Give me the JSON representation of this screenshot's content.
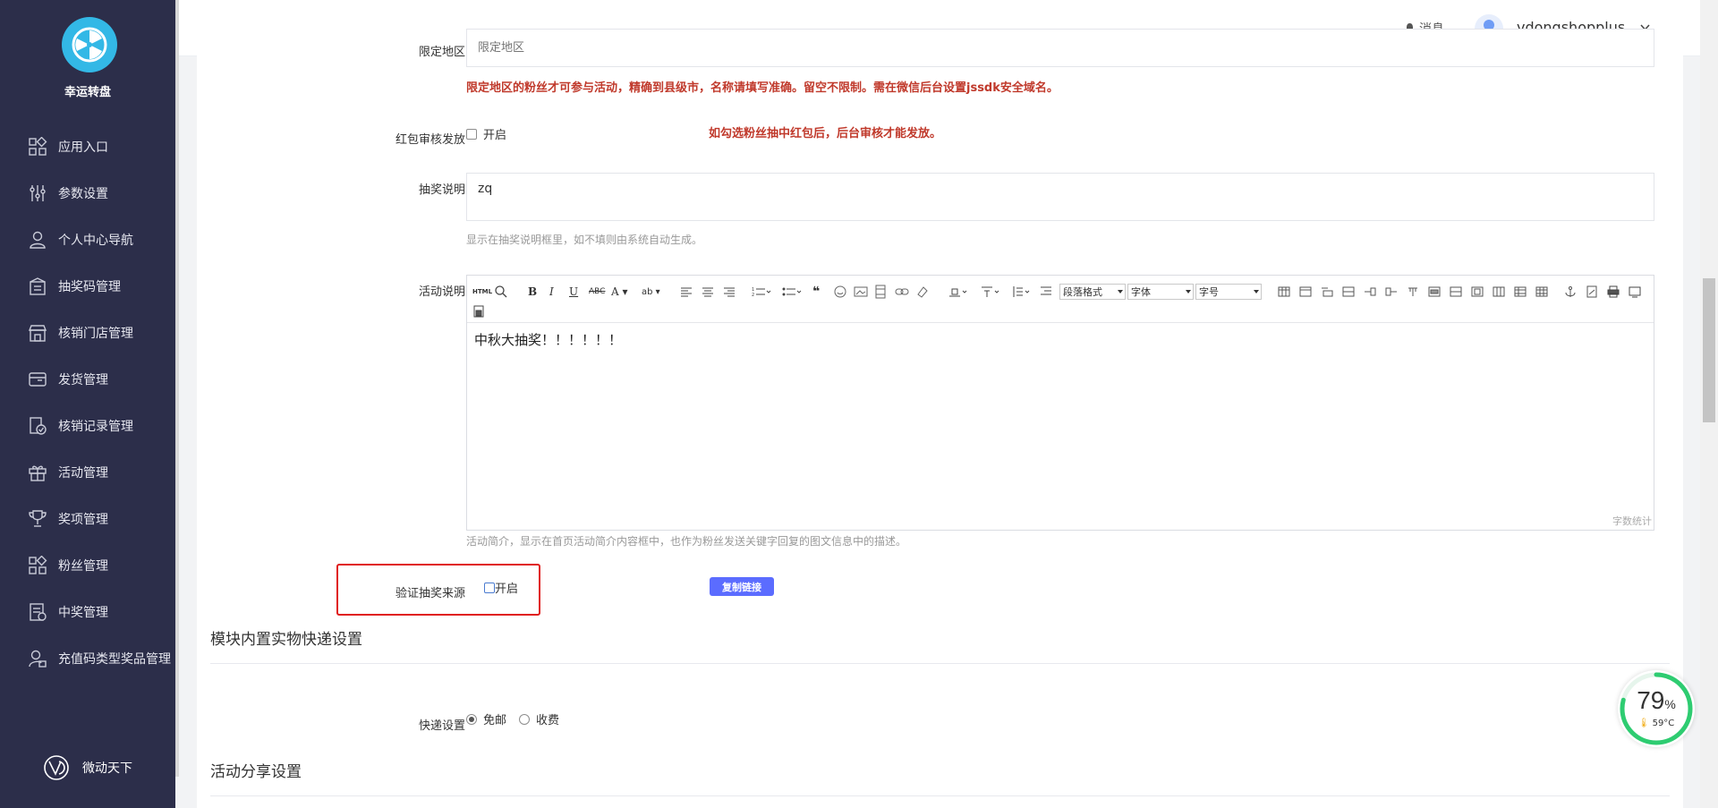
{
  "sidebar": {
    "app_name": "幸运转盘",
    "items": [
      {
        "label": "应用入口",
        "icon": "grid-icon"
      },
      {
        "label": "参数设置",
        "icon": "sliders-icon"
      },
      {
        "label": "个人中心导航",
        "icon": "user-icon"
      },
      {
        "label": "抽奖码管理",
        "icon": "ticket-icon"
      },
      {
        "label": "核销门店管理",
        "icon": "store-icon"
      },
      {
        "label": "发货管理",
        "icon": "shipping-icon"
      },
      {
        "label": "核销记录管理",
        "icon": "record-check-icon"
      },
      {
        "label": "活动管理",
        "icon": "gift-icon"
      },
      {
        "label": "奖项管理",
        "icon": "trophy-icon"
      },
      {
        "label": "粉丝管理",
        "icon": "fans-icon"
      },
      {
        "label": "中奖管理",
        "icon": "prize-list-icon"
      },
      {
        "label": "充值码类型奖品管理",
        "icon": "recharge-icon"
      }
    ],
    "footer": "微动天下"
  },
  "header": {
    "messages": "消息",
    "username": "vdongshopplus"
  },
  "form": {
    "region": {
      "label": "限定地区",
      "placeholder": "限定地区",
      "hint": "限定地区的粉丝才可参与活动，精确到县级市，名称请填写准确。留空不限制。需在微信后台设置jssdk安全域名。"
    },
    "redpack_review": {
      "label": "红包审核发放",
      "option": "开启",
      "checked": false,
      "hint": "如勾选粉丝抽中红包后，后台审核才能发放。"
    },
    "lottery_desc": {
      "label": "抽奖说明",
      "value": "zq",
      "hint": "显示在抽奖说明框里，如不填则由系统自动生成。"
    },
    "activity_desc": {
      "label": "活动说明",
      "content": "中秋大抽奖！！！！！！",
      "word_count": "字数统计",
      "hint": "活动简介，显示在首页活动简介内容框中，也作为粉丝发送关键字回复的图文信息中的描述。",
      "toolbar": {
        "html": "HTML",
        "paragraph": "段落格式",
        "font": "字体",
        "font_size": "字号"
      }
    },
    "verify_source": {
      "label": "验证抽奖来源",
      "option": "开启",
      "checked": false,
      "copy_button": "复制链接"
    }
  },
  "sections": {
    "express": {
      "title": "模块内置实物快递设置",
      "label": "快递设置",
      "options": [
        "免邮",
        "收费"
      ],
      "selected": "免邮"
    },
    "share": {
      "title": "活动分享设置"
    }
  },
  "gauge": {
    "percent": "79",
    "unit": "%",
    "temperature": "59°C",
    "level": 0.79,
    "color": "#2ecc71"
  },
  "colors": {
    "sidebar_bg": "#2c2e4a",
    "accent": "#5b6cff",
    "hint_red": "#c0392b",
    "highlight": "#e01b1b"
  }
}
